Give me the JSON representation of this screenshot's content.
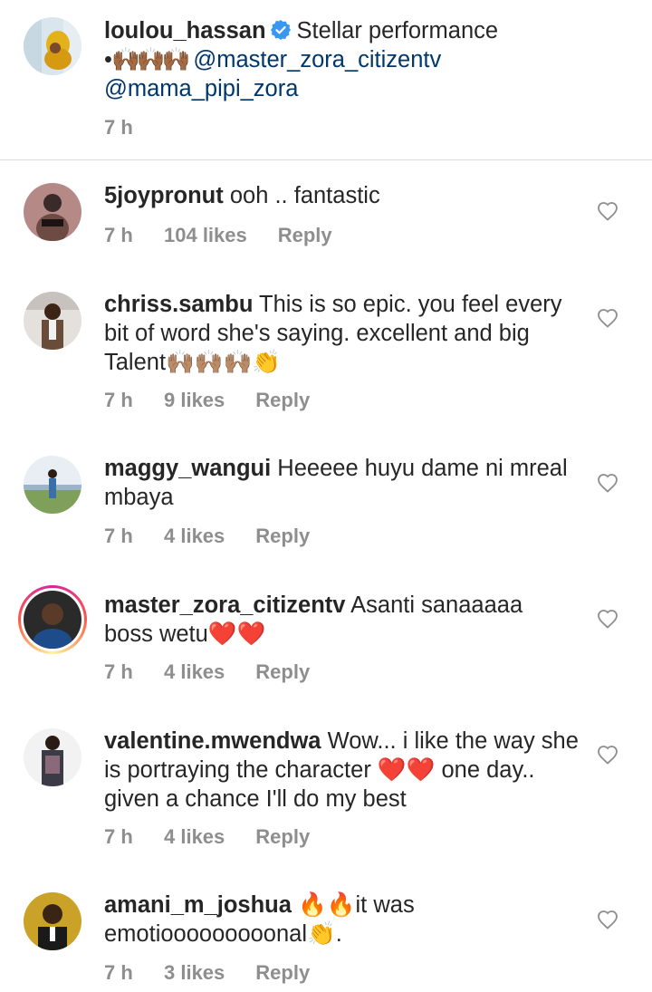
{
  "caption": {
    "username": "loulou_hassan",
    "text": "Stellar performance",
    "line2_prefix": "• 🙌🏾🙌🏾🙌🏾",
    "mention1": "@master_zora_citizentv",
    "mention2": "@mama_pipi_zora",
    "time": "7 h"
  },
  "comments": [
    {
      "username": "5joypronut",
      "text": "ooh .. fantastic",
      "time": "7 h",
      "likes": "104 likes",
      "reply": "Reply"
    },
    {
      "username": "chriss.sambu",
      "text": "This is so epic. you feel every bit of word she's saying. excellent and big Talent🙌🏽🙌🏽🙌🏽👏",
      "time": "7 h",
      "likes": "9 likes",
      "reply": "Reply"
    },
    {
      "username": "maggy_wangui",
      "text": "Heeeee huyu dame ni mreal mbaya",
      "time": "7 h",
      "likes": "4 likes",
      "reply": "Reply"
    },
    {
      "username": "master_zora_citizentv",
      "text": "Asanti sanaaaaa boss wetu❤️❤️",
      "time": "7 h",
      "likes": "4 likes",
      "reply": "Reply"
    },
    {
      "username": "valentine.mwendwa",
      "text": "Wow... i like  the way she is portraying the character ❤️❤️ one day.. given a chance I'll do my best",
      "time": "7 h",
      "likes": "4 likes",
      "reply": "Reply"
    },
    {
      "username": "amani_m_joshua",
      "text": "🔥🔥it was emotiooooooooonal👏.",
      "time": "7 h",
      "likes": "3 likes",
      "reply": "Reply"
    }
  ],
  "icons": {
    "verified": "verified-badge-icon",
    "heart": "heart-outline-icon"
  },
  "colors": {
    "mention": "#00376b",
    "meta": "#8e8e8e",
    "verified": "#3897f0"
  }
}
